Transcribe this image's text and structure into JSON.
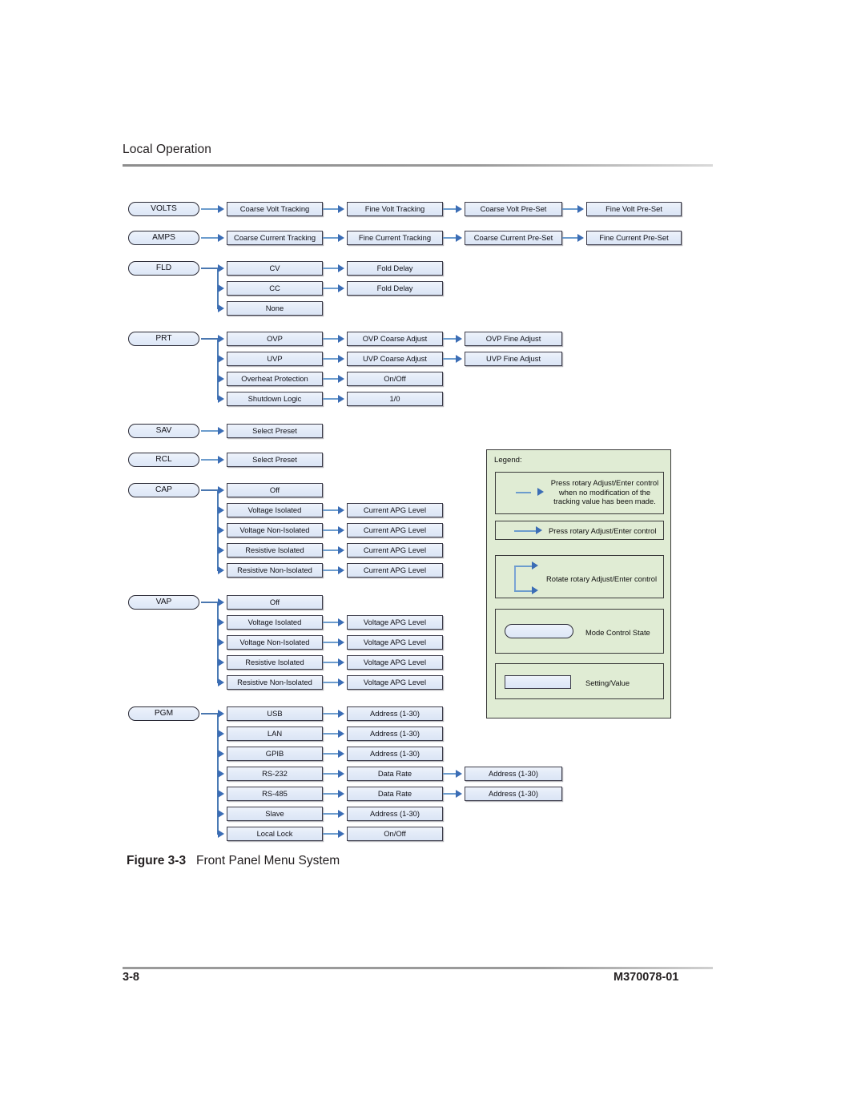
{
  "page": {
    "running_head": "Local Operation",
    "footer_left": "3-8",
    "footer_right": "M370078-01",
    "figure_number": "Figure 3-3",
    "figure_title": "Front Panel Menu System"
  },
  "colors": {
    "node_fill": "#e3ebf8",
    "node_border": "#3c3c4a",
    "connector": "#6c9ccd",
    "arrow": "#3b6db5",
    "legend_fill": "#e0ecd4",
    "legend_border": "#3b3b3b",
    "rule": "#9a9a9a"
  },
  "diagram": {
    "groups": [
      {
        "key": "volts",
        "root": "VOLTS",
        "rows": [
          [
            "Coarse Volt Tracking",
            "Fine Volt Tracking",
            "Coarse Volt Pre-Set",
            "Fine Volt Pre-Set"
          ]
        ]
      },
      {
        "key": "amps",
        "root": "AMPS",
        "rows": [
          [
            "Coarse Current Tracking",
            "Fine Current Tracking",
            "Coarse Current Pre-Set",
            "Fine Current Pre-Set"
          ]
        ]
      },
      {
        "key": "fld",
        "root": "FLD",
        "rows": [
          [
            "CV",
            "Fold Delay"
          ],
          [
            "CC",
            "Fold Delay"
          ],
          [
            "None"
          ]
        ]
      },
      {
        "key": "prt",
        "root": "PRT",
        "rows": [
          [
            "OVP",
            "OVP Coarse Adjust",
            "OVP Fine Adjust"
          ],
          [
            "UVP",
            "UVP Coarse Adjust",
            "UVP Fine Adjust"
          ],
          [
            "Overheat Protection",
            "On/Off"
          ],
          [
            "Shutdown Logic",
            "1/0"
          ]
        ]
      },
      {
        "key": "sav",
        "root": "SAV",
        "rows": [
          [
            "Select Preset"
          ]
        ]
      },
      {
        "key": "rcl",
        "root": "RCL",
        "rows": [
          [
            "Select Preset"
          ]
        ]
      },
      {
        "key": "cap",
        "root": "CAP",
        "rows": [
          [
            "Off"
          ],
          [
            "Voltage Isolated",
            "Current APG Level"
          ],
          [
            "Voltage Non-Isolated",
            "Current APG Level"
          ],
          [
            "Resistive Isolated",
            "Current APG Level"
          ],
          [
            "Resistive Non-Isolated",
            "Current APG Level"
          ]
        ]
      },
      {
        "key": "vap",
        "root": "VAP",
        "rows": [
          [
            "Off"
          ],
          [
            "Voltage Isolated",
            "Voltage APG Level"
          ],
          [
            "Voltage Non-Isolated",
            "Voltage APG Level"
          ],
          [
            "Resistive Isolated",
            "Voltage APG Level"
          ],
          [
            "Resistive Non-Isolated",
            "Voltage APG Level"
          ]
        ]
      },
      {
        "key": "pgm",
        "root": "PGM",
        "rows": [
          [
            "USB",
            "Address (1-30)"
          ],
          [
            "LAN",
            "Address (1-30)"
          ],
          [
            "GPIB",
            "Address (1-30)"
          ],
          [
            "RS-232",
            "Data Rate",
            "Address (1-30)"
          ],
          [
            "RS-485",
            "Data Rate",
            "Address (1-30)"
          ],
          [
            "Slave",
            "Address (1-30)"
          ],
          [
            "Local Lock",
            "On/Off"
          ]
        ]
      }
    ]
  },
  "legend": {
    "title": "Legend:",
    "entries": [
      {
        "symbol": "short-dash-arrow",
        "text": "Press rotary Adjust/Enter control when no modification of the tracking value has been made."
      },
      {
        "symbol": "line-arrow",
        "text": "Press rotary Adjust/Enter control"
      },
      {
        "symbol": "branch-two-arrows",
        "text": "Rotate rotary Adjust/Enter control"
      },
      {
        "symbol": "pill-shape",
        "text": "Mode Control State"
      },
      {
        "symbol": "rect-shape",
        "text": "Setting/Value"
      }
    ]
  }
}
